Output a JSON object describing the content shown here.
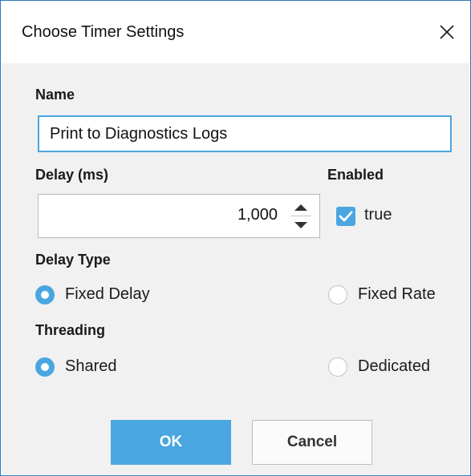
{
  "dialog": {
    "title": "Choose Timer Settings"
  },
  "fields": {
    "name_label": "Name",
    "name_value": "Print to Diagnostics Logs",
    "delay_label": "Delay (ms)",
    "delay_value": "1,000",
    "enabled_label": "Enabled",
    "enabled_checked": true,
    "enabled_text": "true"
  },
  "delay_type": {
    "label": "Delay Type",
    "options": [
      "Fixed Delay",
      "Fixed Rate"
    ],
    "selected": "Fixed Delay"
  },
  "threading": {
    "label": "Threading",
    "options": [
      "Shared",
      "Dedicated"
    ],
    "selected": "Shared"
  },
  "buttons": {
    "ok": "OK",
    "cancel": "Cancel"
  },
  "colors": {
    "accent": "#4aa6e0",
    "window_border": "#2b79c2",
    "panel_bg": "#f1f1f1"
  },
  "icons": [
    "close-icon",
    "chevron-up-icon",
    "chevron-down-icon",
    "checkmark-icon"
  ]
}
